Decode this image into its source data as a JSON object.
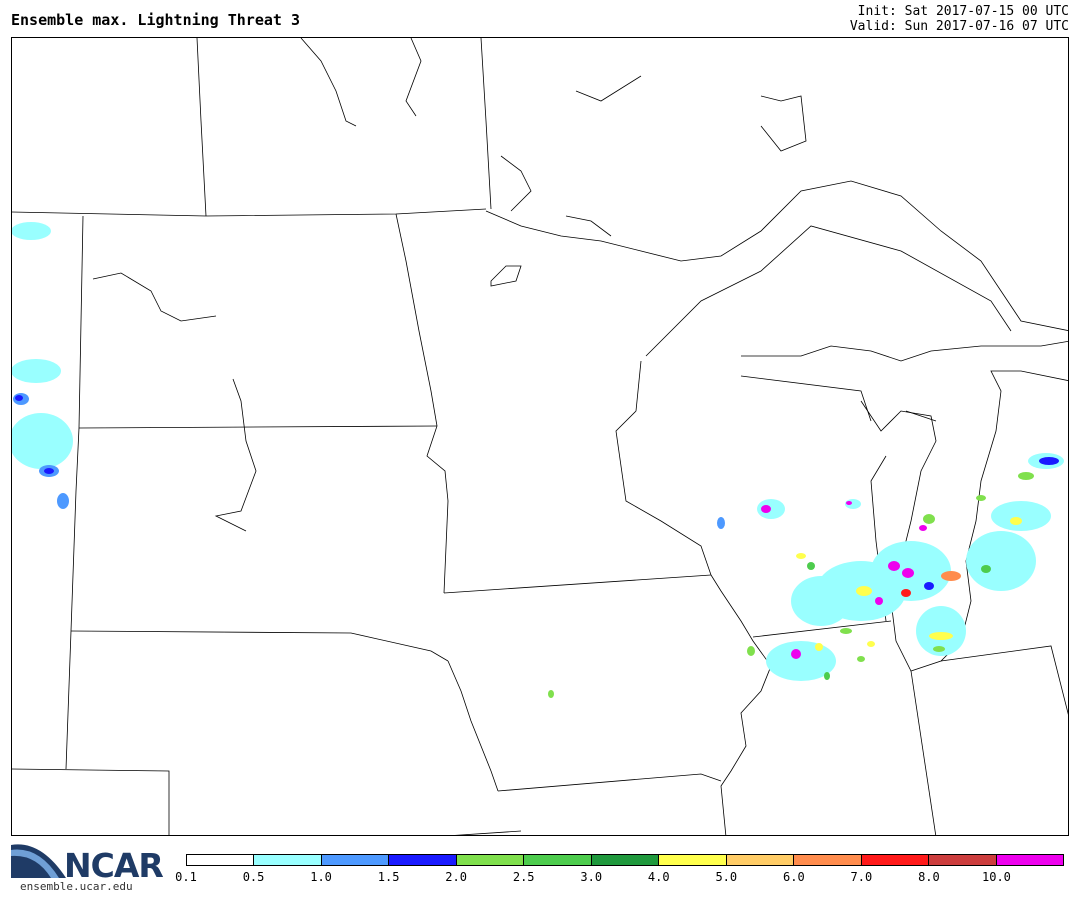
{
  "header": {
    "title": "Ensemble max. Lightning Threat 3",
    "init": "Init: Sat 2017-07-15 00 UTC",
    "valid": "Valid: Sun 2017-07-16 07 UTC"
  },
  "logo": {
    "name": "NCAR",
    "url": "ensemble.ucar.edu"
  },
  "legend": {
    "labels": [
      "0.1",
      "0.5",
      "1.0",
      "1.5",
      "2.0",
      "2.5",
      "3.0",
      "4.0",
      "5.0",
      "6.0",
      "7.0",
      "8.0",
      "10.0"
    ],
    "colors": [
      "#ffffff",
      "#99ffff",
      "#4d99ff",
      "#1a1aff",
      "#80e04d",
      "#4dcc4d",
      "#1f993d",
      "#ffff4d",
      "#ffcc66",
      "#ff8c4d",
      "#ff1a1a",
      "#cc3d3d",
      "#ee00ee"
    ]
  }
}
